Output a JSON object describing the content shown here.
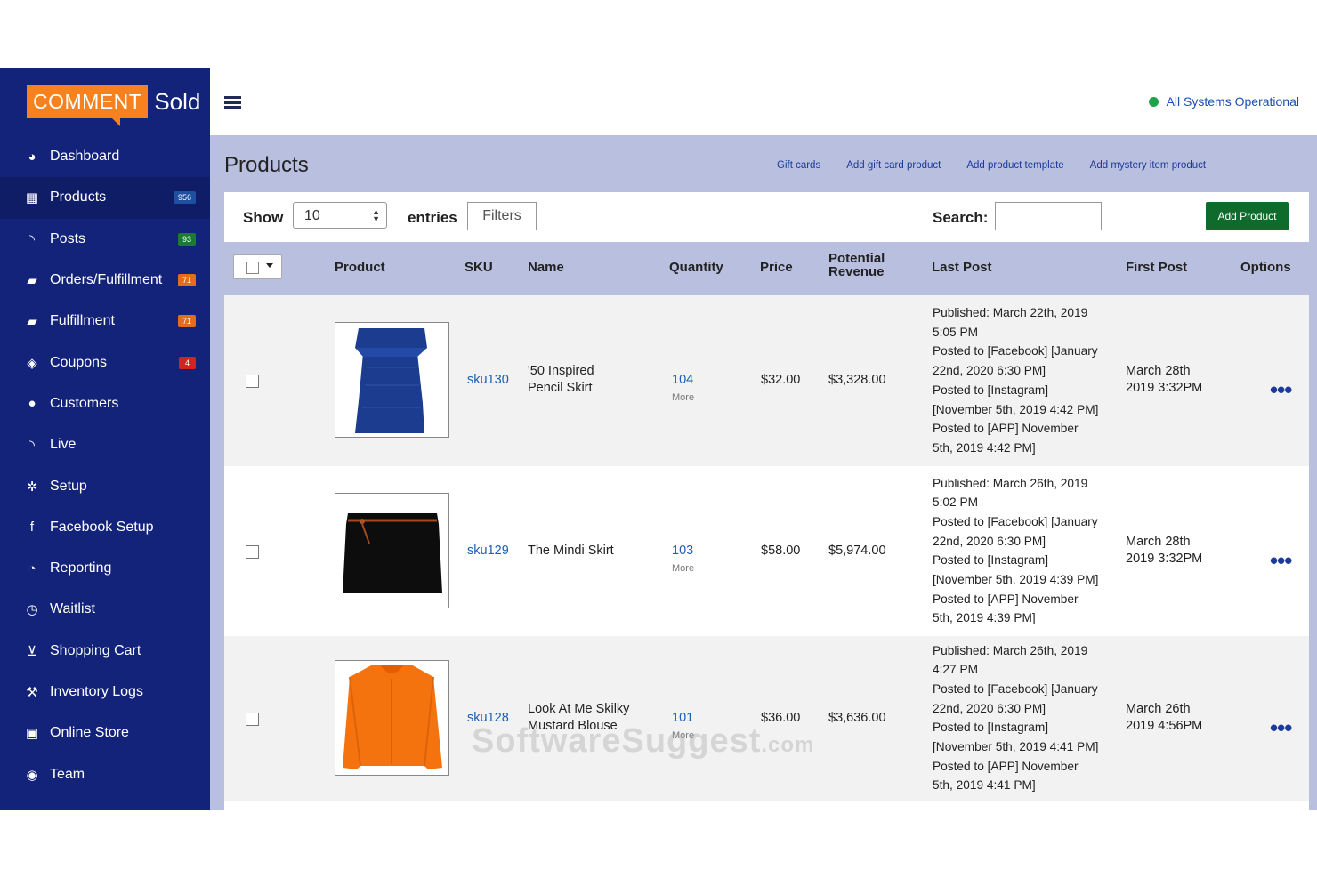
{
  "brand": {
    "box": "COMMENT",
    "text": "Sold",
    "accent": "#f5821f"
  },
  "sidebar": {
    "items": [
      {
        "label": "Dashboard",
        "icon": "dashboard-icon"
      },
      {
        "label": "Products",
        "icon": "grid-icon",
        "badge": "956",
        "badge_color": "#1f4fa0",
        "active": true
      },
      {
        "label": "Posts",
        "icon": "rss-icon",
        "badge": "93",
        "badge_color": "#1b7a34"
      },
      {
        "label": "Orders/Fulfillment",
        "icon": "truck-icon",
        "badge": "71",
        "badge_color": "#e46c1a"
      },
      {
        "label": "Fulfillment",
        "icon": "truck-icon",
        "badge": "71",
        "badge_color": "#e46c1a"
      },
      {
        "label": "Coupons",
        "icon": "tag-icon",
        "badge": "4",
        "badge_color": "#d32222"
      },
      {
        "label": "Customers",
        "icon": "user-icon"
      },
      {
        "label": "Live",
        "icon": "rss-icon"
      },
      {
        "label": "Setup",
        "icon": "gears-icon"
      },
      {
        "label": "Facebook Setup",
        "icon": "facebook-icon"
      },
      {
        "label": "Reporting",
        "icon": "pie-chart-icon"
      },
      {
        "label": "Waitlist",
        "icon": "clock-icon"
      },
      {
        "label": "Shopping Cart",
        "icon": "cart-icon"
      },
      {
        "label": "Inventory Logs",
        "icon": "wrench-icon"
      },
      {
        "label": "Online Store",
        "icon": "bag-icon"
      },
      {
        "label": "Team",
        "icon": "user-circle-icon"
      }
    ]
  },
  "topbar": {
    "status": "All Systems Operational",
    "status_color": "#1fa34a"
  },
  "page": {
    "title": "Products",
    "links": [
      "Gift cards",
      "Add gift card product",
      "Add product template",
      "Add mystery item product"
    ]
  },
  "toolbar": {
    "show_label": "Show",
    "entries_value": "10",
    "entries_label": "entries",
    "filters_label": "Filters",
    "search_label": "Search:",
    "search_value": "",
    "add_product_label": "Add Product"
  },
  "table": {
    "headers": {
      "product": "Product",
      "sku": "SKU",
      "name": "Name",
      "quantity": "Quantity",
      "price": "Price",
      "potential_revenue_1": "Potential",
      "potential_revenue_2": "Revenue",
      "last_post": "Last Post",
      "first_post": "First Post",
      "options": "Options"
    },
    "rows": [
      {
        "image": "blue-pencil-skirt",
        "sku": "sku130",
        "name_1": "'50 Inspired",
        "name_2": "Pencil Skirt",
        "quantity": "104",
        "more": "More",
        "price": "$32.00",
        "revenue": "$3,328.00",
        "last_post": [
          "Published: March 22th, 2019",
          "5:05 PM",
          "Posted to [Facebook] [January",
          "22nd, 2020 6:30 PM]",
          "Posted to [Instagram]",
          "[November 5th, 2019 4:42 PM]",
          "Posted to [APP] November",
          "5th, 2019 4:42 PM]"
        ],
        "first_post_1": "March 28th",
        "first_post_2": "2019 3:32PM"
      },
      {
        "image": "black-mini-skirt",
        "sku": "sku129",
        "name_1": "The Mindi Skirt",
        "name_2": "",
        "quantity": "103",
        "more": "More",
        "price": "$58.00",
        "revenue": "$5,974.00",
        "last_post": [
          "Published: March 26th, 2019",
          "5:02 PM",
          "Posted to [Facebook] [January",
          "22nd, 2020 6:30 PM]",
          "Posted to [Instagram]",
          "[November 5th, 2019 4:39 PM]",
          "Posted to [APP] November",
          "5th, 2019 4:39 PM]"
        ],
        "first_post_1": "March 28th",
        "first_post_2": "2019 3:32PM"
      },
      {
        "image": "orange-blouse",
        "sku": "sku128",
        "name_1": "Look At Me Skilky",
        "name_2": "Mustard Blouse",
        "quantity": "101",
        "more": "More",
        "price": "$36.00",
        "revenue": "$3,636.00",
        "last_post": [
          "Published: March 26th, 2019",
          "4:27 PM",
          "Posted to [Facebook] [January",
          "22nd, 2020 6:30 PM]",
          "Posted to [Instagram]",
          "[November 5th, 2019 4:41 PM]",
          "Posted to [APP] November",
          "5th, 2019 4:41 PM]"
        ],
        "first_post_1": "March 26th",
        "first_post_2": "2019 4:56PM"
      }
    ]
  },
  "watermark": {
    "main": "SoftwareSuggest",
    "suffix": ".com"
  }
}
